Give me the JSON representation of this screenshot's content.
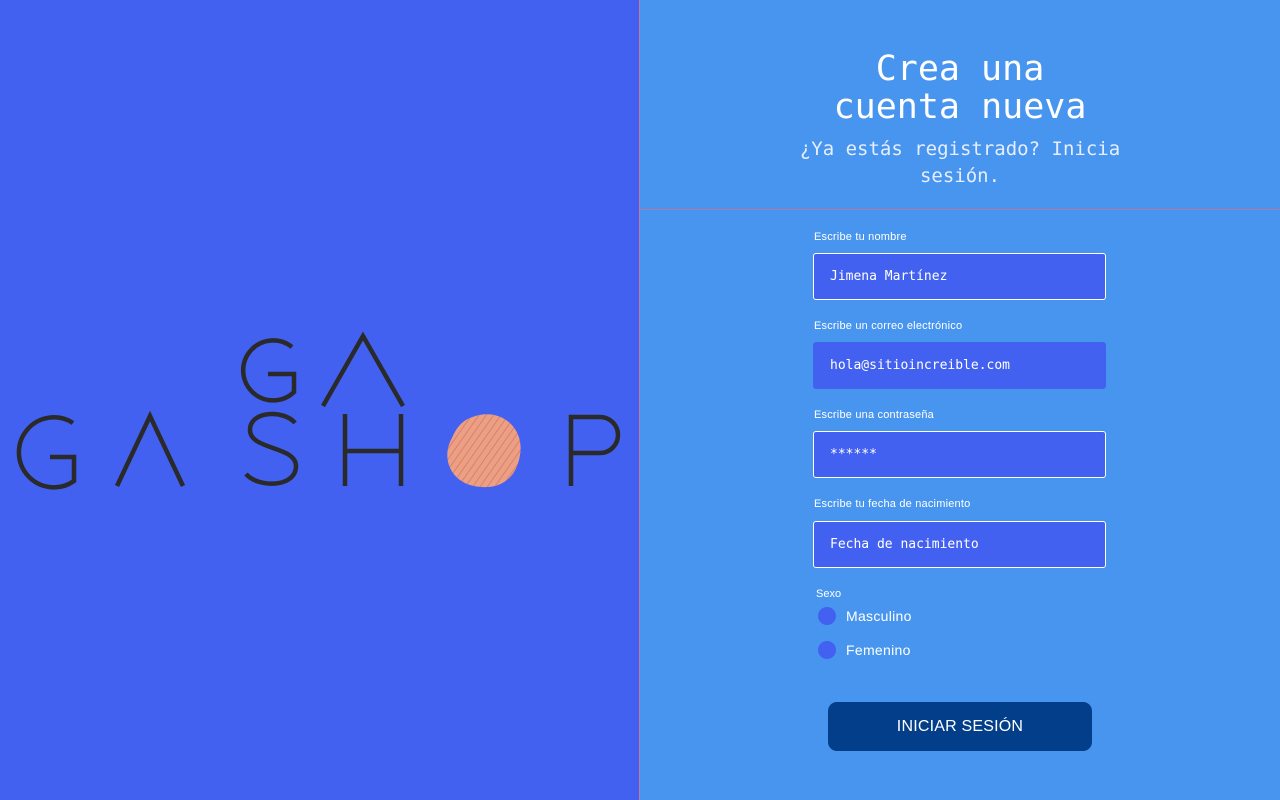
{
  "brand": {
    "logo_text_top": "GA",
    "logo_text_bottom": "GASHOP"
  },
  "header": {
    "title_line1": "Crea una",
    "title_line2": "cuenta nueva",
    "subtitle_text": "¿Ya estás registrado?",
    "subtitle_link": "Inicia sesión."
  },
  "form": {
    "name": {
      "label": "Escribe tu nombre",
      "placeholder": "Jimena Martínez"
    },
    "email": {
      "label": "Escribe un correo electrónico",
      "placeholder": "hola@sitioincreible.com"
    },
    "password": {
      "label": "Escribe una contraseña",
      "placeholder": "******"
    },
    "birthdate": {
      "label": "Escribe tu fecha de nacimiento",
      "placeholder": "Fecha de nacimiento"
    },
    "sex": {
      "label": "Sexo",
      "options": [
        "Masculino",
        "Femenino"
      ]
    },
    "submit_label": "INICIAR SESIÓN"
  },
  "colors": {
    "left_bg": "#4361f0",
    "right_bg": "#4895ef",
    "input_bg": "#4361f0",
    "button_bg": "#023e8a",
    "logo_dot": "#e8967e"
  },
  "icons": {
    "logo": "gashop-logo",
    "radio": "radio-dot-icon"
  }
}
